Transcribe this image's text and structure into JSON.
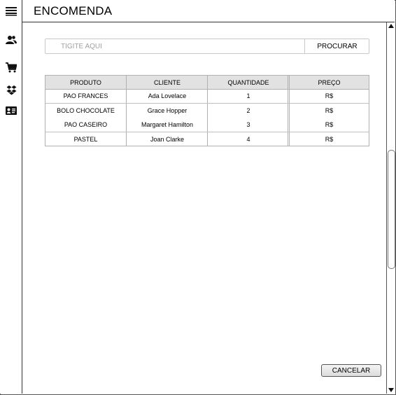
{
  "header": {
    "title": "ENCOMENDA"
  },
  "sidebar": {
    "items": [
      {
        "icon": "menu-icon"
      },
      {
        "icon": "users-icon"
      },
      {
        "icon": "cart-icon"
      },
      {
        "icon": "dropbox-icon"
      },
      {
        "icon": "id-card-icon"
      }
    ]
  },
  "search": {
    "placeholder": "TIGITE AQUI",
    "value": "",
    "button_label": "PROCURAR"
  },
  "table": {
    "columns": [
      "PRODUTO",
      "CLIENTE",
      "QUANTIDADE",
      "PREÇO"
    ],
    "rows": [
      {
        "produto": "PAO FRANCES",
        "cliente": "Ada Lovelace",
        "quantidade": "1",
        "preco": "R$"
      },
      {
        "produto": "BOLO CHOCOLATE",
        "cliente": "Grace Hopper",
        "quantidade": "2",
        "preco": "R$"
      },
      {
        "produto": "PAO CASEIRO",
        "cliente": "Margaret Hamilton",
        "quantidade": "3",
        "preco": "R$"
      },
      {
        "produto": "PASTEL",
        "cliente": "Joan Clarke",
        "quantidade": "4",
        "preco": "R$"
      }
    ]
  },
  "actions": {
    "cancel_label": "CANCELAR"
  }
}
